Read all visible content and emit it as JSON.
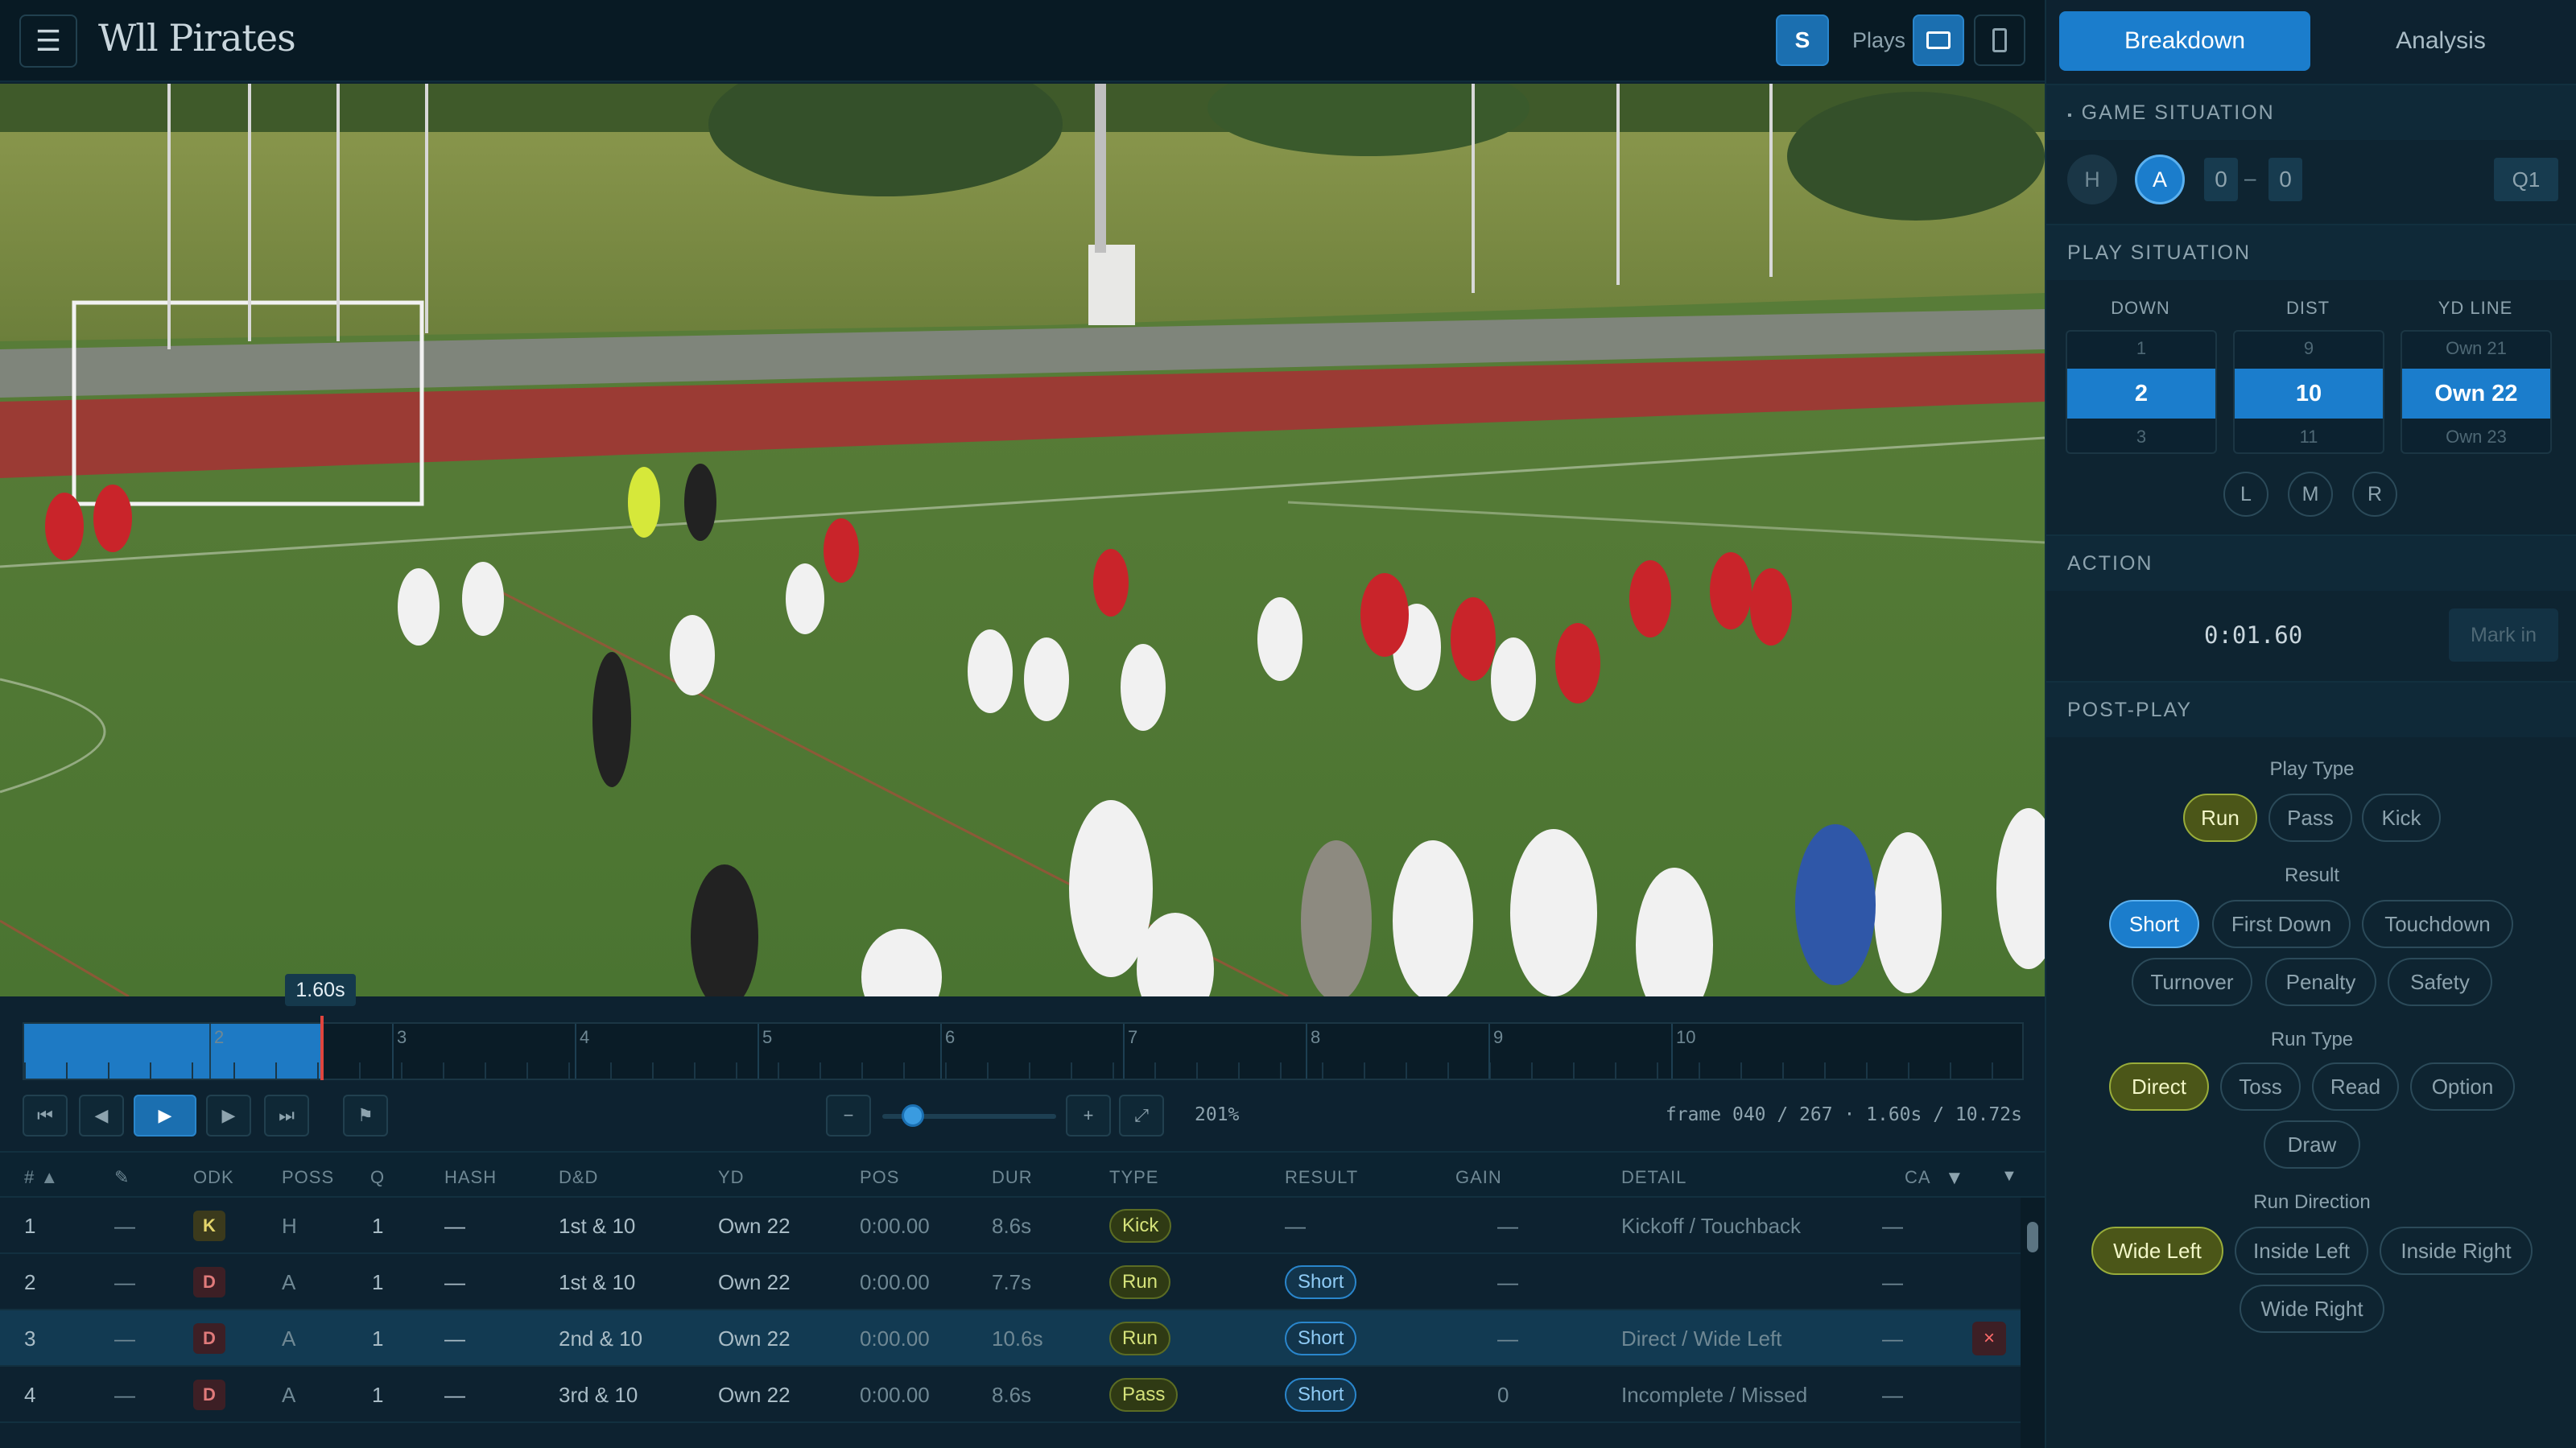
{
  "app": {
    "menu_icon": "menu-icon",
    "title": "Wll Pirates",
    "s_label": "S",
    "plays_label": "Plays"
  },
  "video": {
    "current_time_badge": "1.60s"
  },
  "timeline": {
    "tick_labels": [
      "2",
      "3",
      "4",
      "5",
      "6",
      "7",
      "8",
      "9",
      "10"
    ],
    "played_fraction": 0.149
  },
  "controls": {
    "skip_start": "⏮",
    "prev": "◀",
    "play": "▶",
    "next": "▶",
    "skip_end": "⏭",
    "flag": "⚑",
    "zoom_out": "−",
    "zoom_in": "+",
    "expand": "⤢",
    "zoom_pct": "201%",
    "frame_info": "frame 040 / 267 · 1.60s / 10.72s"
  },
  "table": {
    "headers": {
      "num": "# ▲",
      "pen": "✎",
      "odk": "ODK",
      "poss": "POSS",
      "q": "Q",
      "hash": "HASH",
      "dd": "D&D",
      "yd": "YD",
      "pos": "POS",
      "dur": "DUR",
      "type": "TYPE",
      "result": "RESULT",
      "gain": "GAIN",
      "detail": "DETAIL",
      "ca": "CA"
    },
    "rows": [
      {
        "num": "1",
        "pen": "—",
        "odk": "K",
        "poss": "H",
        "q": "1",
        "hash": "—",
        "dd": "1st & 10",
        "yd": "Own 22",
        "pos": "0:00.00",
        "dur": "8.6s",
        "type": "Kick",
        "result": "—",
        "gain": "—",
        "detail": "Kickoff / Touchback",
        "ca": "—"
      },
      {
        "num": "2",
        "pen": "—",
        "odk": "D",
        "poss": "A",
        "q": "1",
        "hash": "—",
        "dd": "1st & 10",
        "yd": "Own 22",
        "pos": "0:00.00",
        "dur": "7.7s",
        "type": "Run",
        "result": "Short",
        "gain": "—",
        "detail": "",
        "ca": "—"
      },
      {
        "num": "3",
        "pen": "—",
        "odk": "D",
        "poss": "A",
        "q": "1",
        "hash": "—",
        "dd": "2nd & 10",
        "yd": "Own 22",
        "pos": "0:00.00",
        "dur": "10.6s",
        "type": "Run",
        "result": "Short",
        "gain": "—",
        "detail": "Direct / Wide Left",
        "ca": "—",
        "delete": "×"
      },
      {
        "num": "4",
        "pen": "—",
        "odk": "D",
        "poss": "A",
        "q": "1",
        "hash": "—",
        "dd": "3rd & 10",
        "yd": "Own 22",
        "pos": "0:00.00",
        "dur": "8.6s",
        "type": "Pass",
        "result": "Short",
        "gain": "0",
        "detail": "Incomplete / Missed",
        "ca": "—"
      }
    ]
  },
  "panel": {
    "tabs": [
      "Breakdown",
      "Analysis"
    ],
    "game_situation": {
      "title": "GAME SITUATION",
      "home": "H",
      "away": "A",
      "score_home": "0",
      "score_sep": "–",
      "score_away": "0",
      "quarter": "Q1"
    },
    "play_situation": {
      "title": "PLAY SITUATION",
      "down": {
        "label": "DOWN",
        "above": "1",
        "value": "2",
        "below": "3"
      },
      "dist": {
        "label": "DIST",
        "above": "9",
        "value": "10",
        "below": "11"
      },
      "yd_line": {
        "label": "YD LINE",
        "above": "Own 21",
        "value": "Own 22",
        "below": "Own 23"
      },
      "hash": [
        "L",
        "M",
        "R"
      ]
    },
    "action": {
      "title": "ACTION",
      "time": "0:01.60",
      "mark_in": "Mark in"
    },
    "post_play": {
      "title": "POST-PLAY",
      "play_type_label": "Play Type",
      "play_type": [
        "Run",
        "Pass",
        "Kick"
      ],
      "result_label": "Result",
      "result": [
        "Short",
        "First Down",
        "Touchdown",
        "Turnover",
        "Penalty",
        "Safety"
      ],
      "run_type_label": "Run Type",
      "run_type": [
        "Direct",
        "Toss",
        "Read",
        "Option",
        "Draw"
      ],
      "run_direction_label": "Run Direction",
      "run_direction": [
        "Wide Left",
        "Inside Left",
        "Inside Right",
        "Wide Right"
      ]
    }
  }
}
